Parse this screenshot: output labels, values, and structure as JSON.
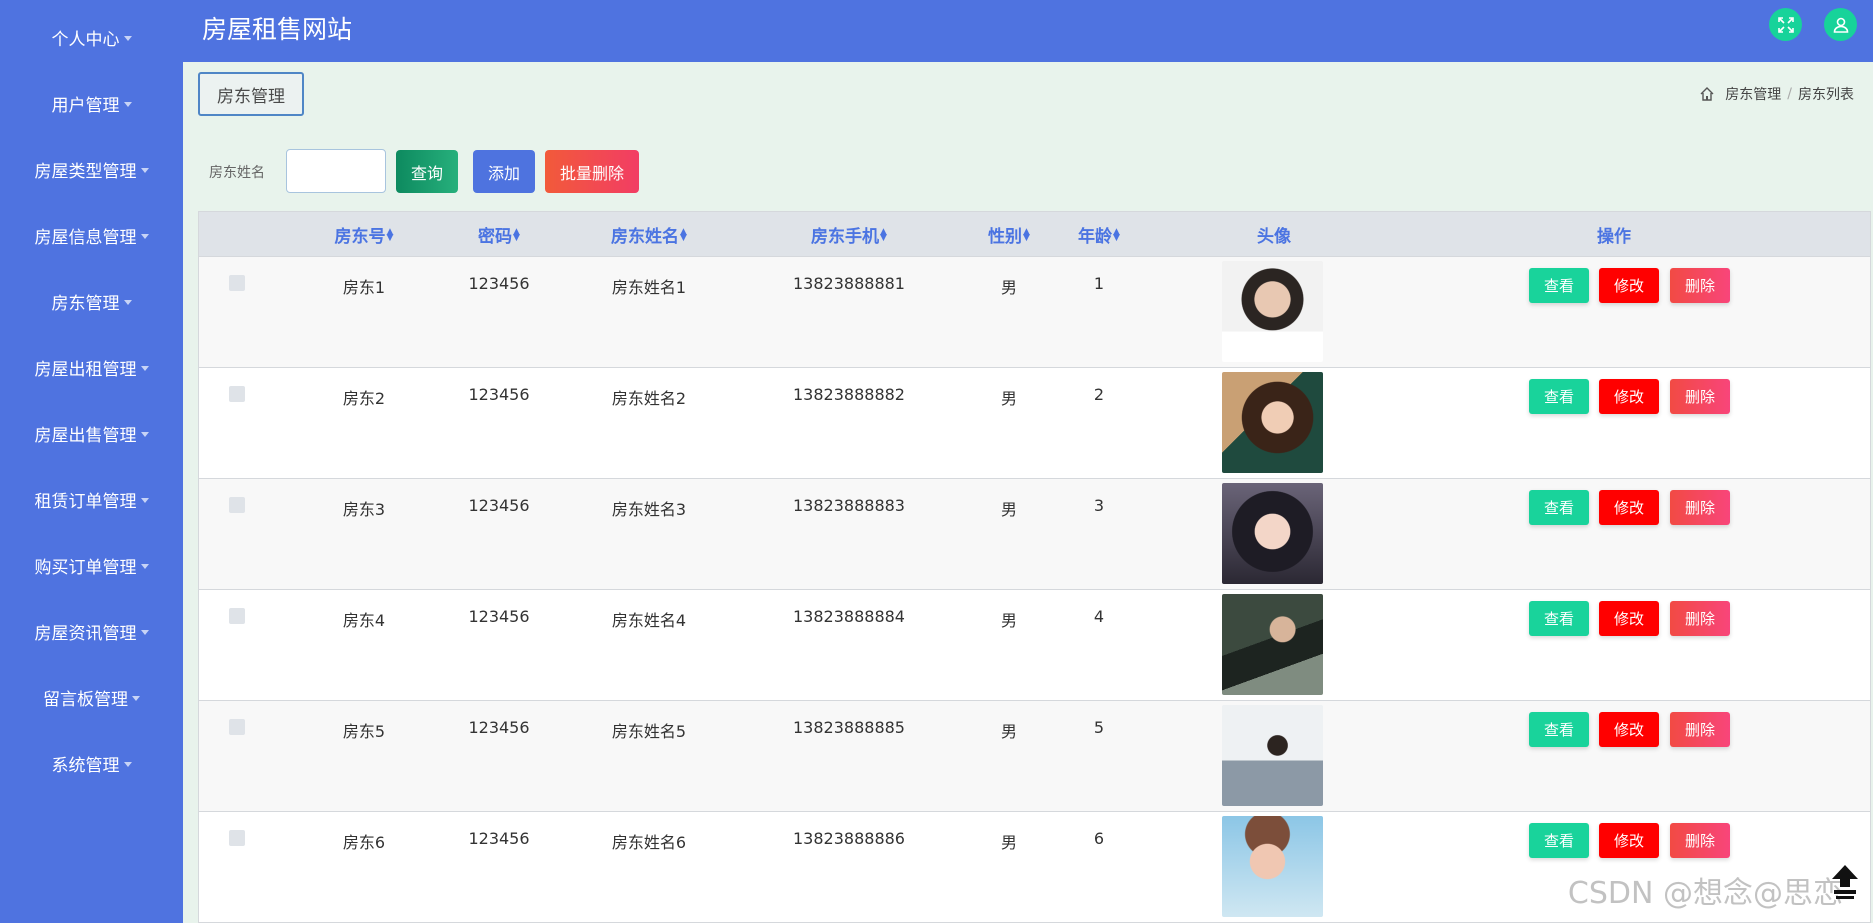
{
  "header": {
    "title": "房屋租售网站"
  },
  "sidebar": {
    "items": [
      {
        "label": "个人中心"
      },
      {
        "label": "用户管理"
      },
      {
        "label": "房屋类型管理"
      },
      {
        "label": "房屋信息管理"
      },
      {
        "label": "房东管理"
      },
      {
        "label": "房屋出租管理"
      },
      {
        "label": "房屋出售管理"
      },
      {
        "label": "租赁订单管理"
      },
      {
        "label": "购买订单管理"
      },
      {
        "label": "房屋资讯管理"
      },
      {
        "label": "留言板管理"
      },
      {
        "label": "系统管理"
      }
    ]
  },
  "panel": {
    "tab_label": "房东管理"
  },
  "breadcrumb": {
    "items": [
      "房东管理",
      "房东列表"
    ]
  },
  "search": {
    "label": "房东姓名",
    "value": "",
    "query_label": "查询",
    "add_label": "添加",
    "batch_delete_label": "批量删除"
  },
  "table": {
    "headers": [
      "房东号",
      "密码",
      "房东姓名",
      "房东手机",
      "性别",
      "年龄",
      "头像",
      "操作"
    ],
    "rows": [
      {
        "id": "房东1",
        "password": "123456",
        "name": "房东姓名1",
        "phone": "13823888881",
        "gender": "男",
        "age": "1"
      },
      {
        "id": "房东2",
        "password": "123456",
        "name": "房东姓名2",
        "phone": "13823888882",
        "gender": "男",
        "age": "2"
      },
      {
        "id": "房东3",
        "password": "123456",
        "name": "房东姓名3",
        "phone": "13823888883",
        "gender": "男",
        "age": "3"
      },
      {
        "id": "房东4",
        "password": "123456",
        "name": "房东姓名4",
        "phone": "13823888884",
        "gender": "男",
        "age": "4"
      },
      {
        "id": "房东5",
        "password": "123456",
        "name": "房东姓名5",
        "phone": "13823888885",
        "gender": "男",
        "age": "5"
      },
      {
        "id": "房东6",
        "password": "123456",
        "name": "房东姓名6",
        "phone": "13823888886",
        "gender": "男",
        "age": "6"
      }
    ],
    "actions": {
      "view": "查看",
      "edit": "修改",
      "delete": "删除"
    }
  },
  "icons": {
    "fullscreen": "expand-icon",
    "user": "user-icon",
    "home": "home-icon",
    "back_to_top": "arrow-up-icon"
  },
  "colors": {
    "primary": "#4f73e0",
    "success": "#19d39b",
    "danger": "#ff0000",
    "content_bg": "#e8f3ec"
  },
  "watermark": "CSDN @想念@思恋"
}
